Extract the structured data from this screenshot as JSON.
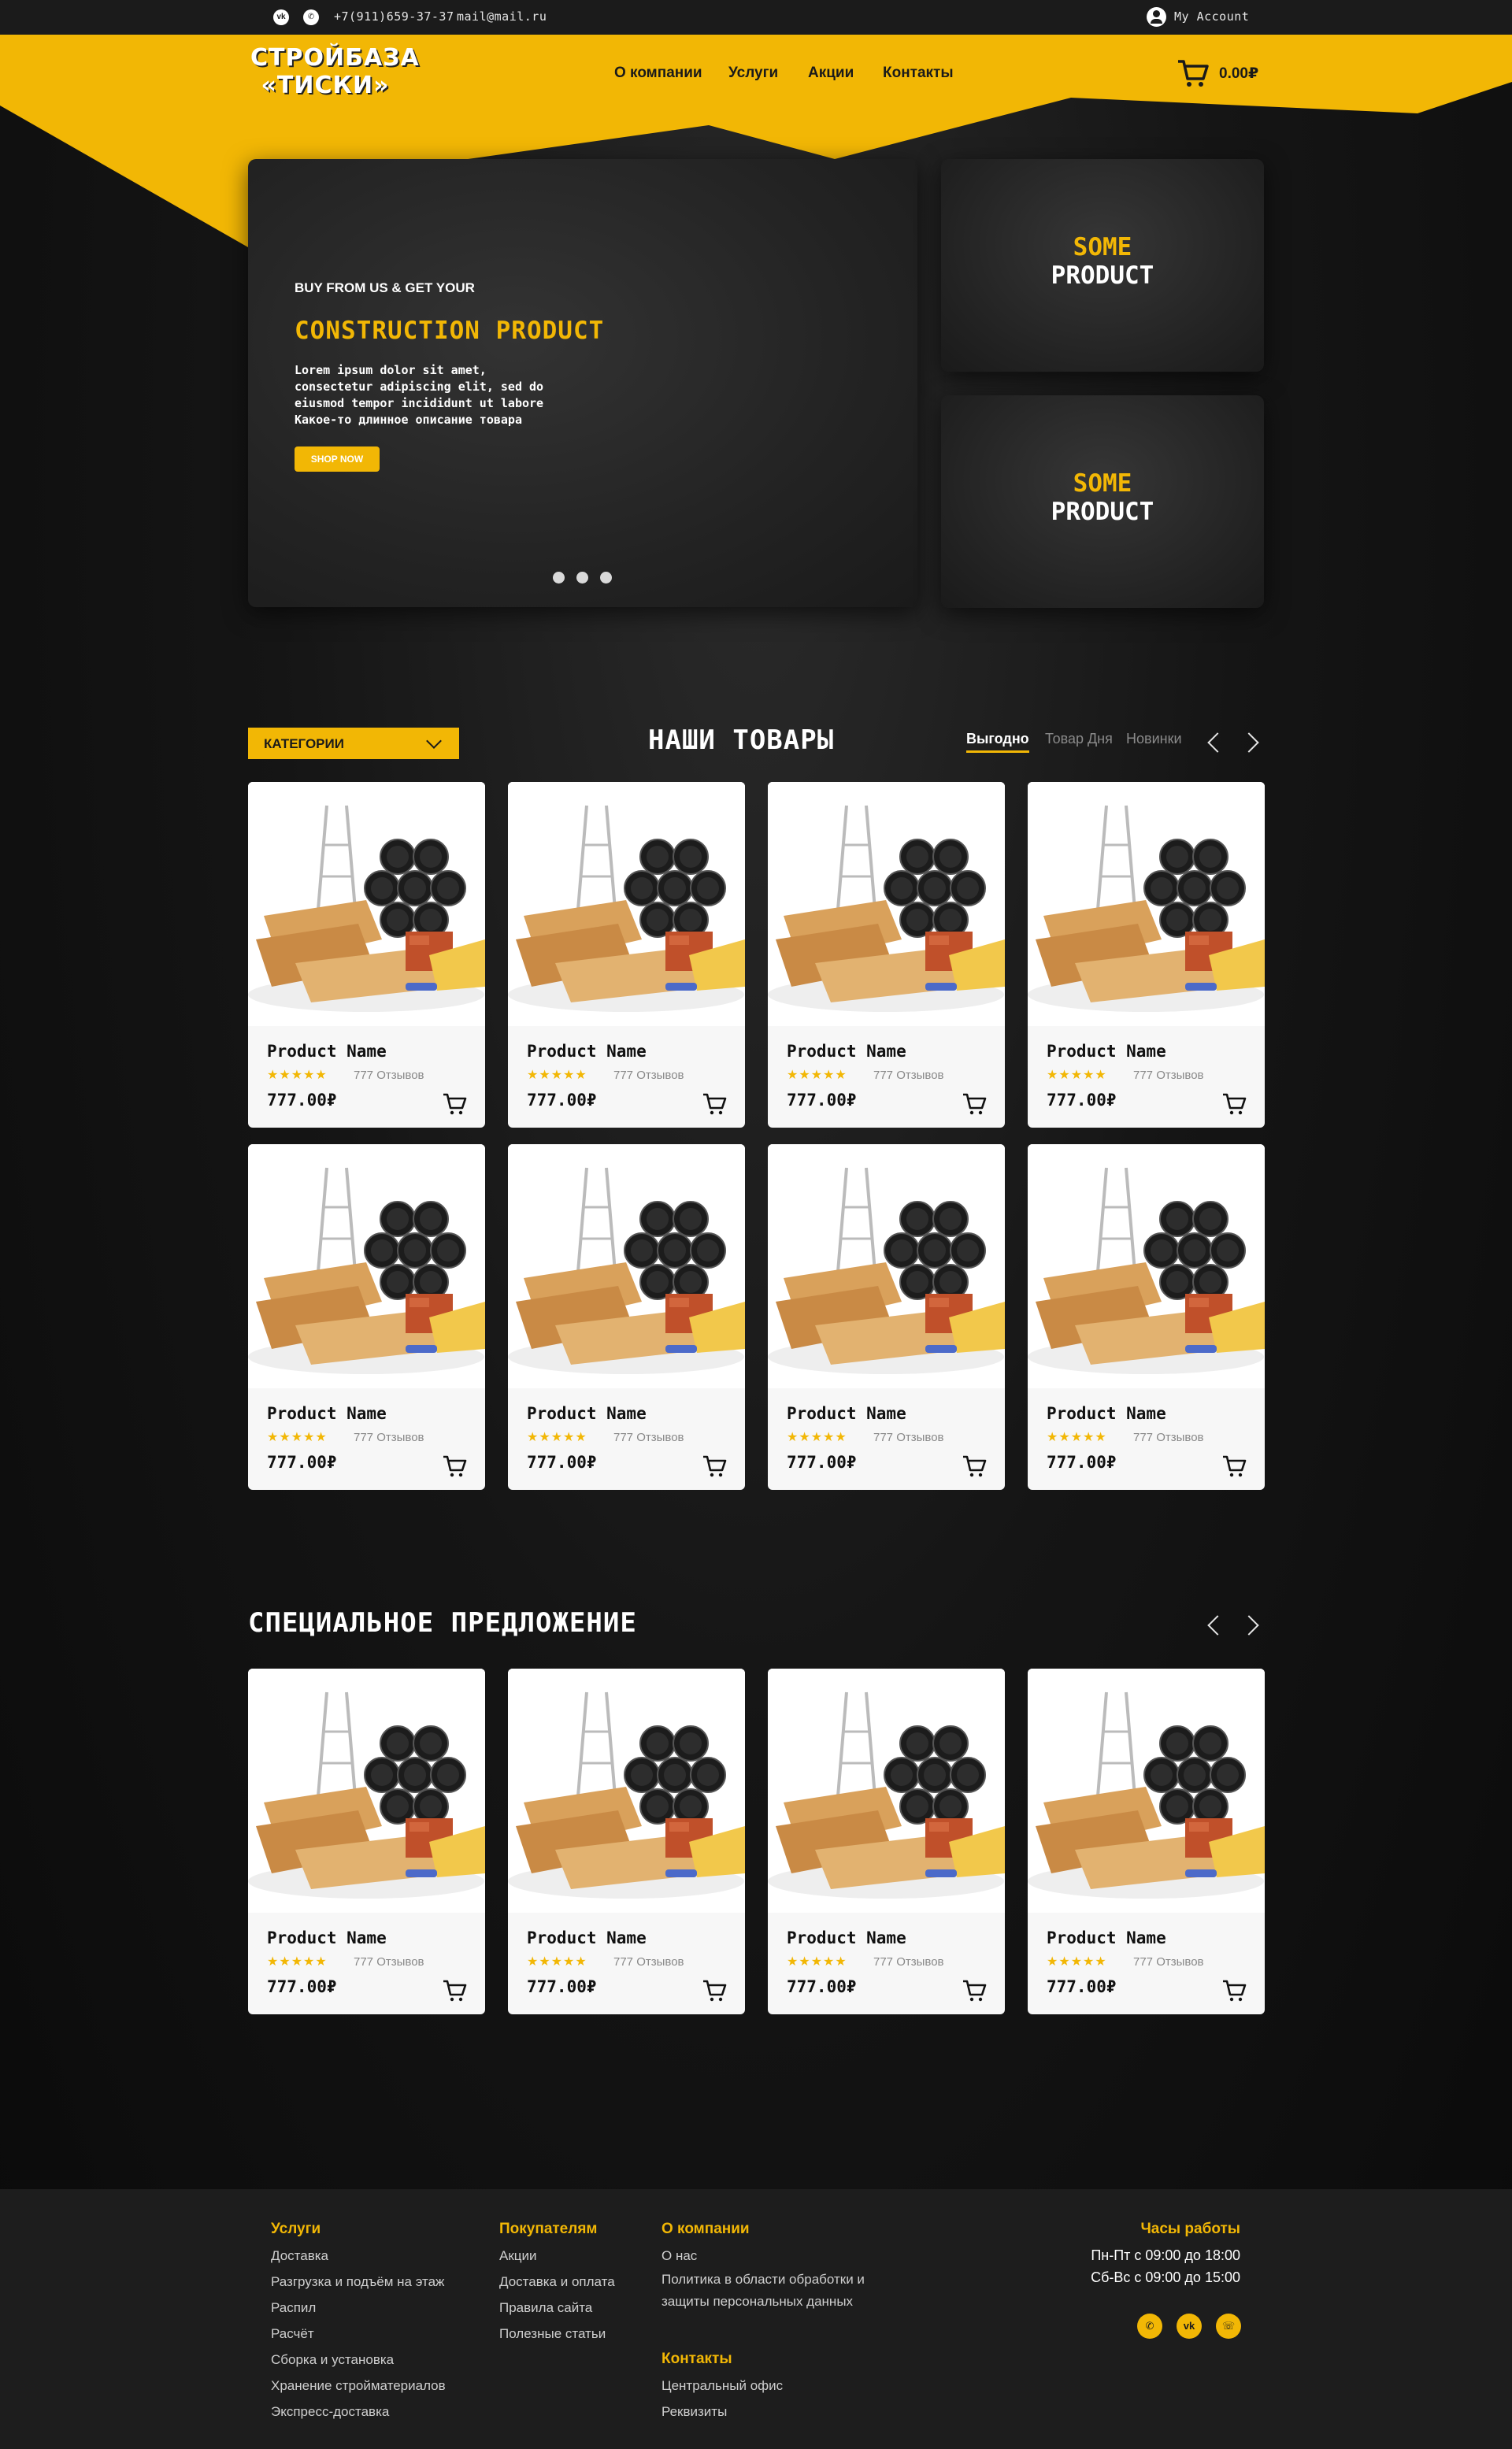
{
  "topbar": {
    "phone": "+7(911)659-37-37",
    "email": "mail@mail.ru",
    "account": "My Account"
  },
  "header": {
    "logo_line1": "СТРОЙБАЗА",
    "logo_line2": "«ТИСКИ»",
    "nav": [
      "О компании",
      "Услуги",
      "Акции",
      "Контакты"
    ],
    "cart_total": "0.00₽"
  },
  "hero": {
    "subtitle": "BUY FROM US & GET YOUR",
    "title": "CONSTRUCTION PRODUCT",
    "description": "Lorem ipsum dolor sit amet, consectetur adipiscing elit, sed do eiusmod tempor incididunt ut labore Какое-то длинное описание товара",
    "button": "SHOP NOW",
    "slides": 3
  },
  "side_promos": [
    {
      "line1": "SOME",
      "line2": "PRODUCT"
    },
    {
      "line1": "SOME",
      "line2": "PRODUCT"
    }
  ],
  "products_section": {
    "category_dropdown": "КАТЕГОРИИ",
    "title": "НАШИ ТОВАРЫ",
    "tabs": [
      "Выгодно",
      "Товар Дня",
      "Новинки"
    ],
    "active_tab": "Выгодно"
  },
  "product": {
    "name": "Product Name",
    "stars": "★★★★★",
    "rating": 5,
    "reviews": "777 Отзывов",
    "price": "777.00₽"
  },
  "special_section": {
    "title": "СПЕЦИАЛЬНОЕ ПРЕДЛОЖЕНИЕ"
  },
  "footer": {
    "services_title": "Услуги",
    "services": [
      "Доставка",
      "Разгрузка и подъём на этаж",
      "Распил",
      "Расчёт",
      "Сборка и установка",
      "Хранение стройматериалов",
      "Экспресс-доставка"
    ],
    "buyers_title": "Покупателям",
    "buyers": [
      "Акции",
      "Доставка и оплата",
      "Правила сайта",
      "Полезные статьи"
    ],
    "about_title": "О компании",
    "about": [
      "О нас",
      "Политика в области обработки и",
      "защиты персональных данных"
    ],
    "contacts_title": "Контакты",
    "contacts": [
      "Центральный офис",
      "Реквизиты"
    ],
    "hours_title": "Часы работы",
    "hours": [
      "Пн-Пт с 09:00 до 18:00",
      "Сб-Вс с 09:00 до 15:00"
    ]
  },
  "colors": {
    "accent": "#f2b705",
    "dark": "#1b1b1b",
    "card": "#f7f7f7"
  }
}
